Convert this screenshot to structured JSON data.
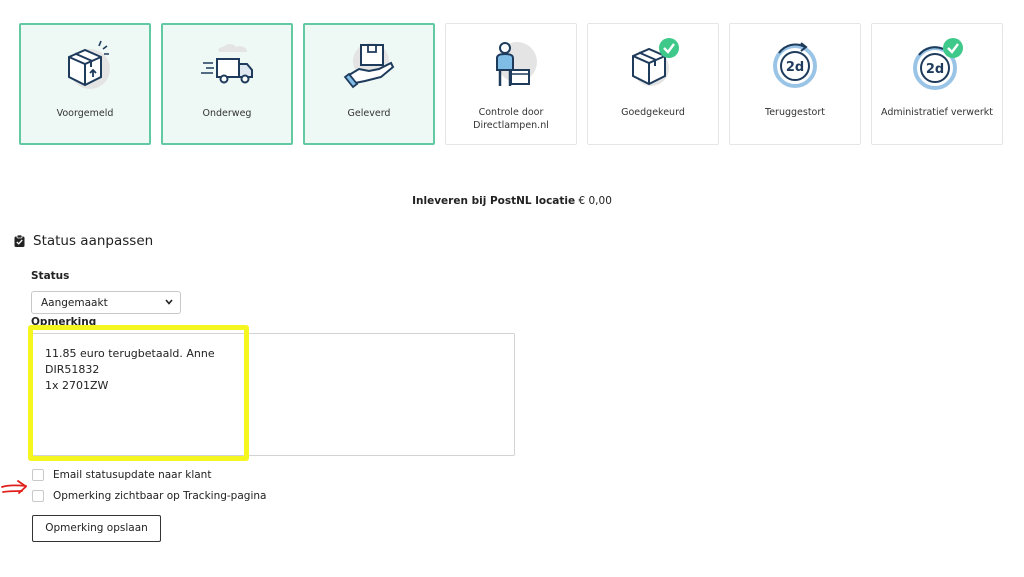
{
  "steps": [
    {
      "label": "Voorgemeld",
      "icon": "box-upload-icon",
      "active": true
    },
    {
      "label": "Onderweg",
      "icon": "delivery-truck-icon",
      "active": true
    },
    {
      "label": "Geleverd",
      "icon": "hand-package-icon",
      "active": true
    },
    {
      "label": "Controle door Directlampen.nl",
      "icon": "person-box-icon",
      "active": false
    },
    {
      "label": "Goedgekeurd",
      "icon": "box-check-icon",
      "active": false
    },
    {
      "label": "Teruggestort",
      "icon": "refund-2d-icon",
      "active": false
    },
    {
      "label": "Administratief verwerkt",
      "icon": "refund-2d-check-icon",
      "active": false
    }
  ],
  "shipping": {
    "method": "Inleveren bij PostNL locatie",
    "price": "€ 0,00"
  },
  "section": {
    "title": "Status aanpassen",
    "icon": "clipboard-icon"
  },
  "form": {
    "status_label": "Status",
    "status_value": "Aangemaakt",
    "remark_label": "Opmerking",
    "remark_lines": [
      "11.85 euro terugbetaald. Anne",
      "DIR51832",
      "1x 2701ZW"
    ],
    "email_checkbox_label": "Email statusupdate naar klant",
    "tracking_checkbox_label": "Opmerking zichtbaar op Tracking-pagina",
    "save_button": "Opmerking opslaan"
  },
  "colors": {
    "active_border": "#62c9a3",
    "active_bg": "#eef8f4",
    "highlight": "#f5f51f",
    "annotation": "#e0201b",
    "check": "#3ec98a"
  }
}
